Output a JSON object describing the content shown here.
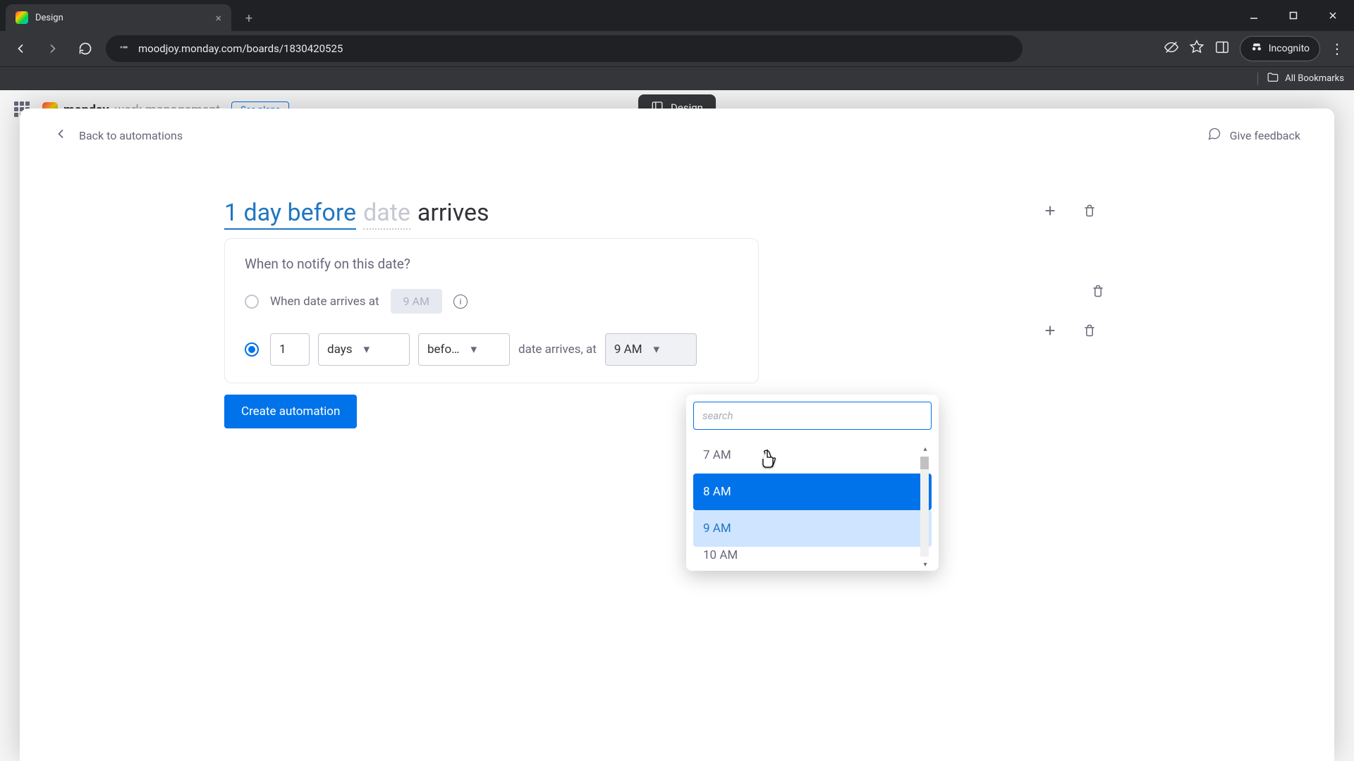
{
  "browser": {
    "tab_title": "Design",
    "url": "moodjoy.monday.com/boards/1830420525",
    "incognito_label": "Incognito",
    "bookmarks_label": "All Bookmarks"
  },
  "page_pill": {
    "label": "Design"
  },
  "background": {
    "brand_bold": "monday",
    "brand_light": "work management",
    "see_plans": "See plans"
  },
  "modal": {
    "back_label": "Back to automations",
    "feedback_label": "Give feedback",
    "sentence": {
      "part1": "1 day before",
      "part2": "date",
      "part3": "arrives"
    },
    "card": {
      "title": "When to notify on this date?",
      "option1_label": "When date arrives at",
      "option1_time": "9 AM",
      "option2_num": "1",
      "option2_unit": "days",
      "option2_rel": "befo…",
      "option2_mid": "date arrives, at",
      "option2_time": "9 AM"
    },
    "create_button": "Create automation"
  },
  "dropdown": {
    "search_placeholder": "search",
    "items": [
      "7 AM",
      "8 AM",
      "9 AM",
      "10 AM"
    ],
    "hover_index": 1,
    "selected_index": 2
  }
}
